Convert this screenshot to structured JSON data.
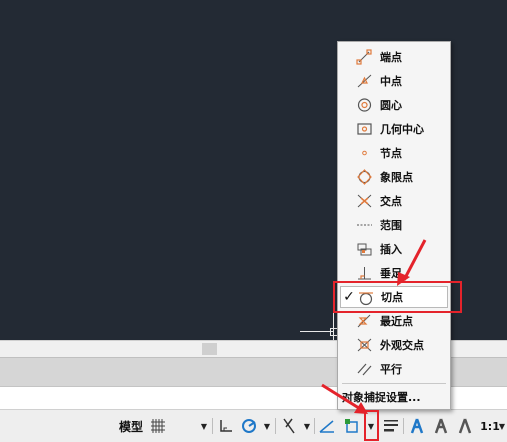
{
  "snap_menu": {
    "items": [
      {
        "label": "端点",
        "icon": "endpoint-icon",
        "checked": false
      },
      {
        "label": "中点",
        "icon": "midpoint-icon",
        "checked": false
      },
      {
        "label": "圆心",
        "icon": "center-icon",
        "checked": false
      },
      {
        "label": "几何中心",
        "icon": "geometric-center-icon",
        "checked": false
      },
      {
        "label": "节点",
        "icon": "node-icon",
        "checked": false
      },
      {
        "label": "象限点",
        "icon": "quadrant-icon",
        "checked": false
      },
      {
        "label": "交点",
        "icon": "intersection-icon",
        "checked": false
      },
      {
        "label": "范围",
        "icon": "extension-icon",
        "checked": false
      },
      {
        "label": "插入",
        "icon": "insertion-icon",
        "checked": false
      },
      {
        "label": "垂足",
        "icon": "perpendicular-icon",
        "checked": false
      },
      {
        "label": "切点",
        "icon": "tangent-icon",
        "checked": true
      },
      {
        "label": "最近点",
        "icon": "nearest-icon",
        "checked": false
      },
      {
        "label": "外观交点",
        "icon": "apparent-intersection-icon",
        "checked": false
      },
      {
        "label": "平行",
        "icon": "parallel-icon",
        "checked": false
      }
    ],
    "check_mark": "✓",
    "settings_label": "对象捕捉设置..."
  },
  "statusbar": {
    "model_label": "模型",
    "scale_label": "1:1",
    "dropdown_glyph": "▼"
  },
  "colors": {
    "canvas": "#232a34",
    "highlight": "#e4232b",
    "snap_icon": "#e07a3c",
    "accent_blue": "#1f78c8"
  }
}
